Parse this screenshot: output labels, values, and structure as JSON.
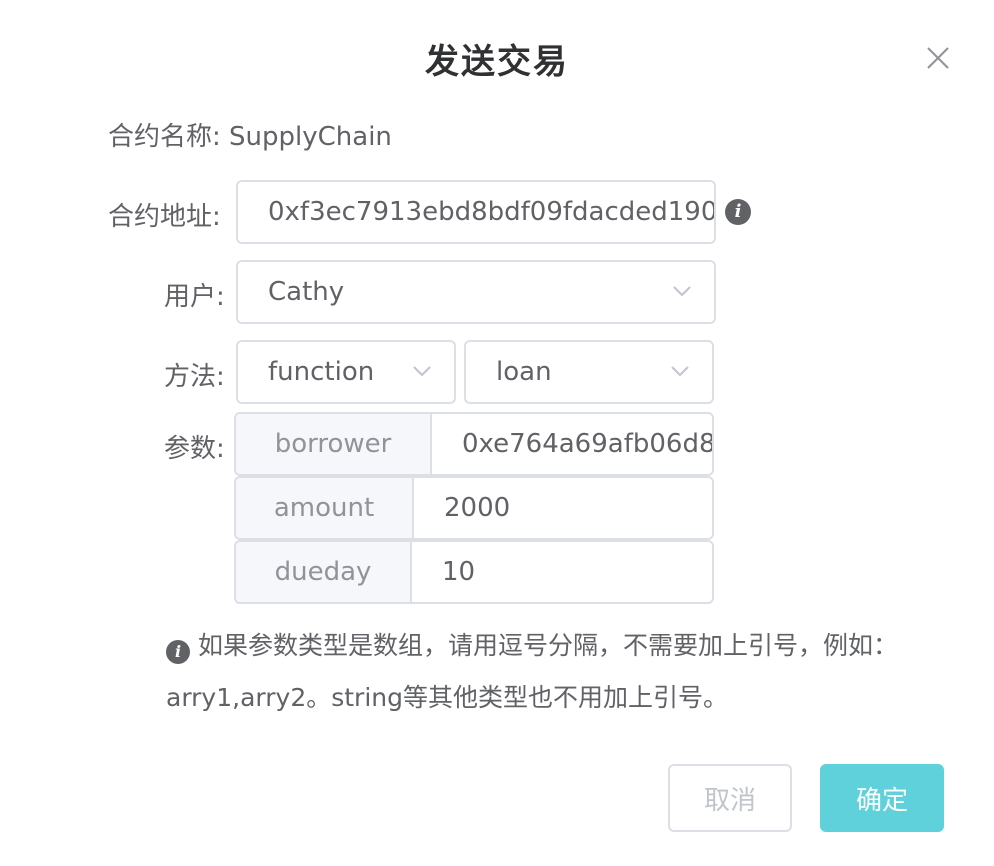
{
  "dialog": {
    "title": "发送交易",
    "close_icon": "close-icon"
  },
  "form": {
    "contract_name_label": "合约名称:",
    "contract_name_value": "SupplyChain",
    "contract_address_label": "合约地址:",
    "contract_address_value": "0xf3ec7913ebd8bdf09fdacded190",
    "user_label": "用户:",
    "user_value": "Cathy",
    "method_label": "方法:",
    "method_type_value": "function",
    "method_name_value": "loan",
    "params_label": "参数:",
    "params": [
      {
        "name": "borrower",
        "value": "0xe764a69afb06d8"
      },
      {
        "name": "amount",
        "value": "2000"
      },
      {
        "name": "dueday",
        "value": "10"
      }
    ]
  },
  "hint": {
    "icon": "info-icon",
    "text": "如果参数类型是数组，请用逗号分隔，不需要加上引号，例如：arry1,arry2。string等其他类型也不用加上引号。"
  },
  "footer": {
    "cancel_label": "取消",
    "confirm_label": "确定"
  },
  "colors": {
    "primary": "#5ed1da",
    "border": "#dcdfe6",
    "text": "#606266",
    "prepend_bg": "#f5f7fa"
  }
}
